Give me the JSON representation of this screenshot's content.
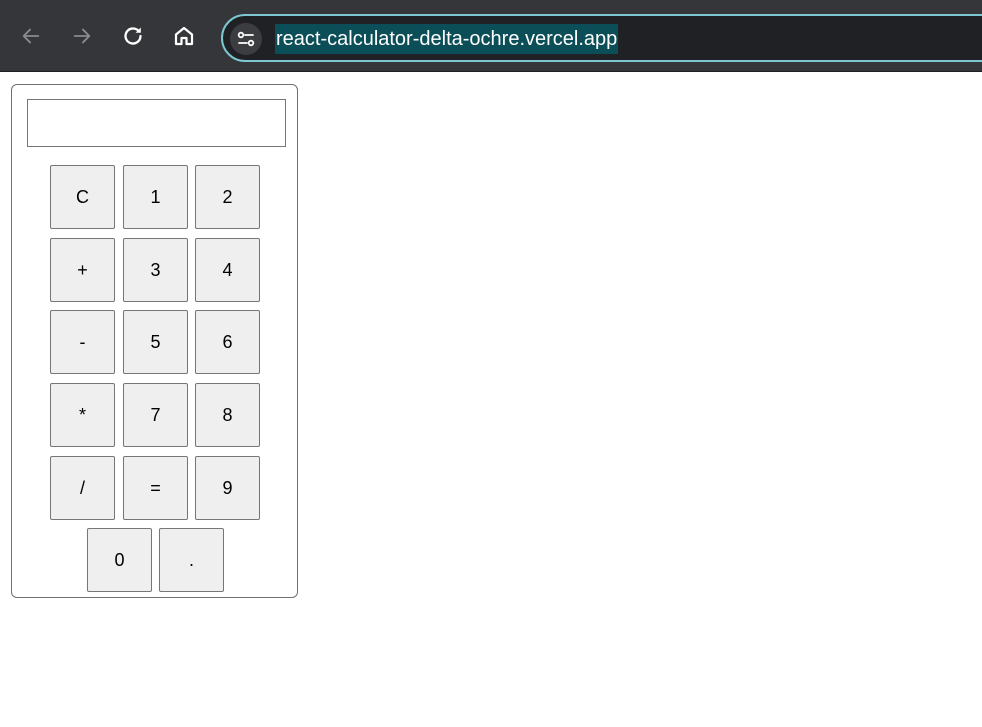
{
  "browser": {
    "url": "react-calculator-delta-ochre.vercel.app",
    "icons": {
      "back": "arrow-left-icon",
      "forward": "arrow-right-icon",
      "reload": "reload-icon",
      "home": "home-icon",
      "site_info": "tune-icon"
    }
  },
  "calculator": {
    "display_value": "",
    "keys": {
      "clear": "C",
      "one": "1",
      "two": "2",
      "plus": "+",
      "three": "3",
      "four": "4",
      "minus": "-",
      "five": "5",
      "six": "6",
      "multiply": "*",
      "seven": "7",
      "eight": "8",
      "divide": "/",
      "equals": "=",
      "nine": "9",
      "zero": "0",
      "decimal": "."
    }
  },
  "colors": {
    "toolbar_bg": "#35363a",
    "omnibox_border": "#7cc7d0",
    "url_highlight": "#0b4e57",
    "key_bg": "#efefef"
  }
}
